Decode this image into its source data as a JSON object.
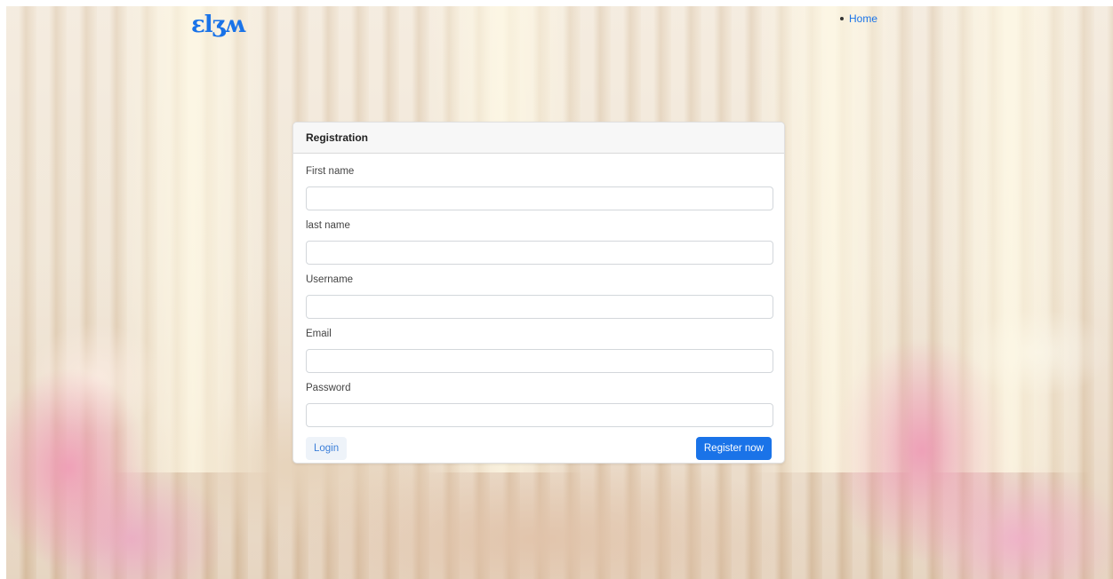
{
  "brand": {
    "logo_text": "ɛlʒʍ",
    "accent_color": "#1a73e8"
  },
  "nav": {
    "items": [
      {
        "label": "Home"
      }
    ]
  },
  "registration": {
    "title": "Registration",
    "fields": [
      {
        "label": "First name",
        "value": "",
        "placeholder": ""
      },
      {
        "label": "last name",
        "value": "",
        "placeholder": ""
      },
      {
        "label": "Username",
        "value": "",
        "placeholder": ""
      },
      {
        "label": "Email",
        "value": "",
        "placeholder": ""
      },
      {
        "label": "Password",
        "value": "",
        "placeholder": ""
      }
    ],
    "login_label": "Login",
    "register_label": "Register now"
  }
}
